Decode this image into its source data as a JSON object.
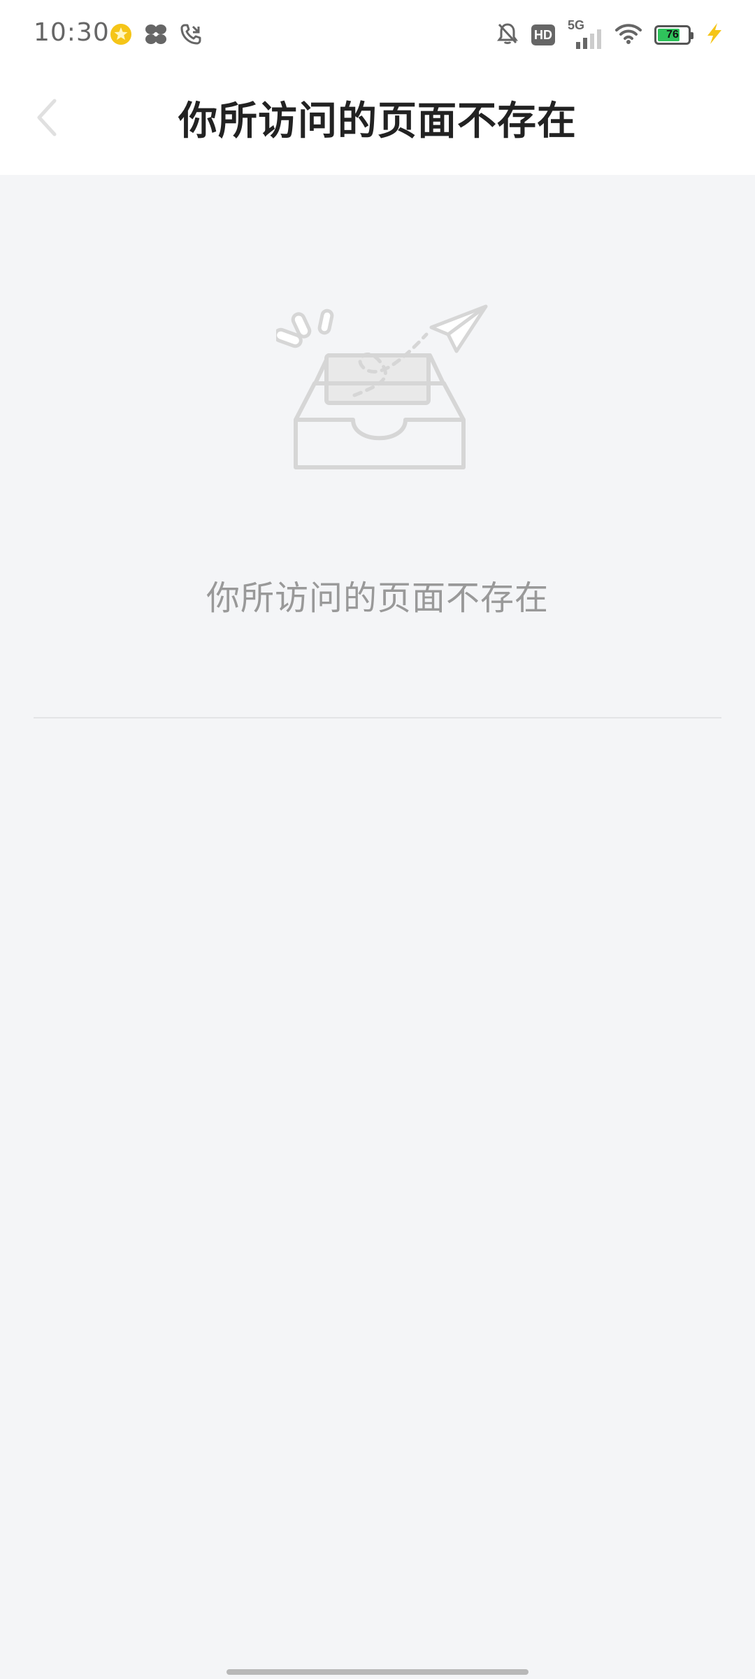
{
  "status_bar": {
    "time": "10:30",
    "network_label": "5G",
    "hd_label": "HD",
    "battery_percent": "76",
    "battery_level": 0.76,
    "icons_left": [
      "star-badge-icon",
      "pinwheel-icon",
      "phone-call-icon"
    ],
    "icons_right": [
      "bell-off-icon",
      "hd-icon",
      "signal-5g-icon",
      "wifi-icon",
      "battery-icon",
      "charging-bolt-icon"
    ]
  },
  "nav": {
    "back_icon": "chevron-left-icon",
    "title": "你所访问的页面不存在"
  },
  "empty_state": {
    "illustration": "empty-inbox-paper-plane-icon",
    "message": "你所访问的页面不存在"
  },
  "colors": {
    "background": "#f4f5f7",
    "title": "#222222",
    "message": "#999999",
    "battery_fill": "#2fc25b",
    "accent_star": "#f5c518",
    "charging_bolt": "#f5c518"
  }
}
